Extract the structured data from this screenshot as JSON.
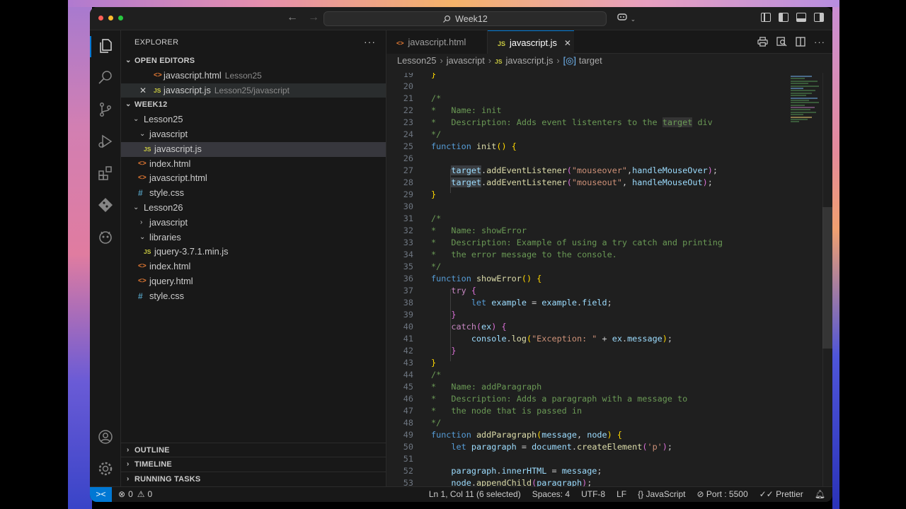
{
  "window": {
    "search_text": "Week12"
  },
  "sidebar": {
    "title": "EXPLORER",
    "more": "···",
    "open_editors": {
      "label": "OPEN EDITORS",
      "items": [
        {
          "icon": "<>",
          "name": "javascript.html",
          "desc": "Lesson25"
        },
        {
          "icon": "JS",
          "name": "javascript.js",
          "desc": "Lesson25/javascript"
        }
      ]
    },
    "workspace": {
      "label": "WEEK12",
      "items": [
        {
          "chev": "⌄",
          "icon": "",
          "name": "Lesson25"
        },
        {
          "chev": "⌄",
          "icon": "",
          "name": "javascript"
        },
        {
          "chev": "",
          "icon": "JS",
          "name": "javascript.js"
        },
        {
          "chev": "",
          "icon": "<>",
          "name": "index.html"
        },
        {
          "chev": "",
          "icon": "<>",
          "name": "javascript.html"
        },
        {
          "chev": "",
          "icon": "#",
          "name": "style.css"
        },
        {
          "chev": "⌄",
          "icon": "",
          "name": "Lesson26"
        },
        {
          "chev": "›",
          "icon": "",
          "name": "javascript"
        },
        {
          "chev": "⌄",
          "icon": "",
          "name": "libraries"
        },
        {
          "chev": "",
          "icon": "JS",
          "name": "jquery-3.7.1.min.js"
        },
        {
          "chev": "",
          "icon": "<>",
          "name": "index.html"
        },
        {
          "chev": "",
          "icon": "<>",
          "name": "jquery.html"
        },
        {
          "chev": "",
          "icon": "#",
          "name": "style.css"
        }
      ]
    },
    "outline": "OUTLINE",
    "timeline": "TIMELINE",
    "running_tasks": "RUNNING TASKS"
  },
  "tabs": [
    {
      "icon": "<>",
      "label": "javascript.html"
    },
    {
      "icon": "JS",
      "label": "javascript.js"
    }
  ],
  "breadcrumbs": {
    "folder1": "Lesson25",
    "folder2": "javascript",
    "file_icon": "JS",
    "file": "javascript.js",
    "symbol": "target"
  },
  "code_lines": [
    19,
    20,
    21,
    22,
    23,
    24,
    25,
    26,
    27,
    28,
    29,
    30,
    31,
    32,
    33,
    34,
    35,
    36,
    37,
    38,
    39,
    40,
    41,
    42,
    43,
    44,
    45,
    46,
    47,
    48,
    49,
    50,
    51,
    52,
    53
  ],
  "status": {
    "errors": "0",
    "warnings": "0",
    "position": "Ln 1, Col 11 (6 selected)",
    "spaces": "Spaces: 4",
    "encoding": "UTF-8",
    "eol": "LF",
    "language": "JavaScript",
    "port": "Port : 5500",
    "prettier": "Prettier"
  },
  "icons": {
    "explorer": "files-icon",
    "search": "search-icon",
    "scm": "source-control-icon",
    "run": "run-debug-icon",
    "extensions": "extensions-icon",
    "git": "git-icon",
    "copilot": "copilot-icon",
    "account": "account-icon",
    "settings": "gear-icon"
  },
  "colors": {
    "accent": "#0078d4",
    "keyword": "#569cd6",
    "function": "#dcdcaa",
    "string": "#ce9178",
    "comment": "#6a9955"
  }
}
